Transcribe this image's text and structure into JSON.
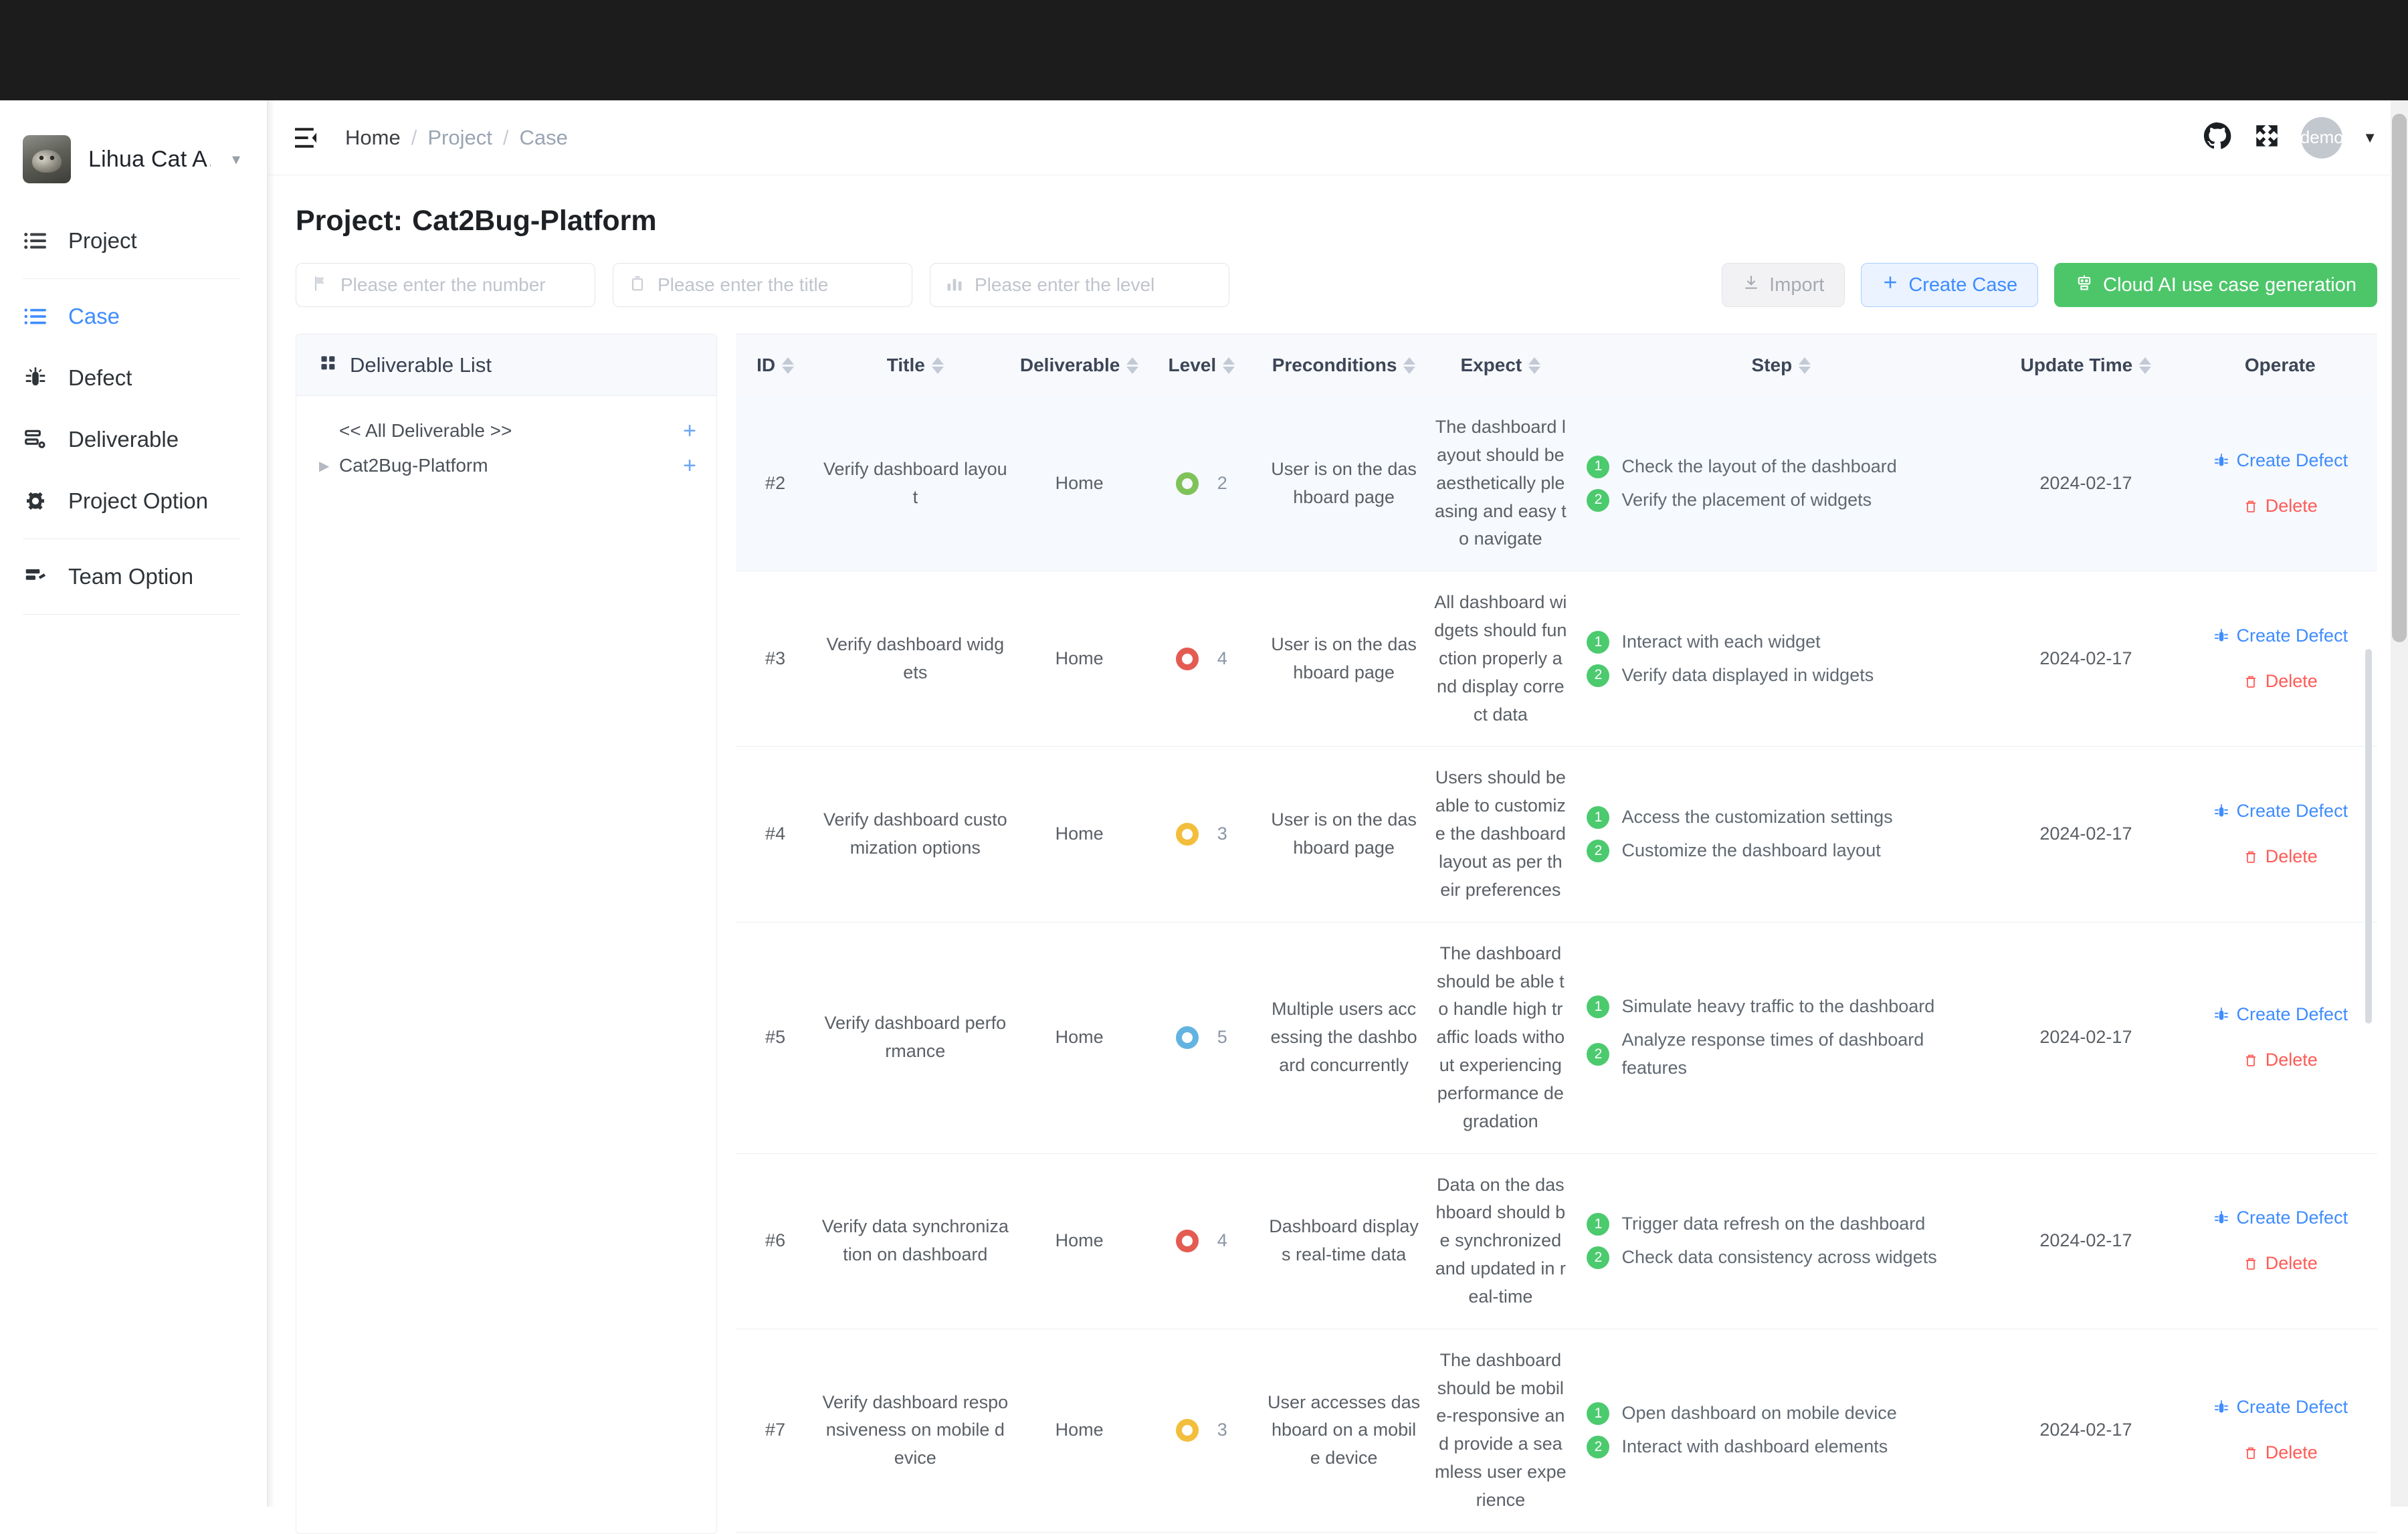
{
  "sidebar": {
    "org": {
      "name": "Lihua Cat A…",
      "avatar_icon": "cat-avatar",
      "caret_icon": "chevron-down-icon"
    },
    "items": [
      {
        "label": "Project",
        "icon": "list-icon",
        "active": false
      },
      {
        "label": "Case",
        "icon": "case-list-icon",
        "active": true
      },
      {
        "label": "Defect",
        "icon": "bug-icon",
        "active": false
      },
      {
        "label": "Deliverable",
        "icon": "deliverable-icon",
        "active": false
      },
      {
        "label": "Project Option",
        "icon": "gear-icon",
        "active": false
      },
      {
        "label": "Team Option",
        "icon": "team-option-icon",
        "active": false
      }
    ]
  },
  "topbar": {
    "menu_icon": "collapse-menu-icon",
    "breadcrumbs": [
      {
        "label": "Home",
        "current": true
      },
      {
        "label": "Project",
        "current": false
      },
      {
        "label": "Case",
        "current": false
      }
    ],
    "separator": "/",
    "github_icon": "github-icon",
    "fullscreen_icon": "fullscreen-icon",
    "user_avatar_label": "demo",
    "user_caret_icon": "caret-down-icon"
  },
  "page": {
    "title_prefix": "Project:",
    "title_name": "Cat2Bug-Platform"
  },
  "filters": [
    {
      "placeholder": "Please enter the number",
      "value": "",
      "icon": "flag-icon",
      "name": "number"
    },
    {
      "placeholder": "Please enter the title",
      "value": "",
      "icon": "clipboard-icon",
      "name": "title"
    },
    {
      "placeholder": "Please enter the level",
      "value": "",
      "icon": "bar-chart-icon",
      "name": "level"
    }
  ],
  "actions": {
    "import": {
      "label": "Import",
      "icon": "download-icon"
    },
    "create_case": {
      "label": "Create Case",
      "icon": "plus-icon"
    },
    "cloud_ai": {
      "label": "Cloud AI use case generation",
      "icon": "robot-icon"
    }
  },
  "deliverable_panel": {
    "title": "Deliverable List",
    "title_icon": "grid-icon",
    "rows": [
      {
        "label": "<< All Deliverable >>",
        "expandable": false,
        "add_icon": "plus-icon"
      },
      {
        "label": "Cat2Bug-Platform",
        "expandable": true,
        "add_icon": "plus-icon",
        "arrow_icon": "caret-right-icon"
      }
    ]
  },
  "table": {
    "columns": [
      {
        "label": "ID",
        "sortable": true
      },
      {
        "label": "Title",
        "sortable": true
      },
      {
        "label": "Deliverable",
        "sortable": true
      },
      {
        "label": "Level",
        "sortable": true
      },
      {
        "label": "Preconditions",
        "sortable": true
      },
      {
        "label": "Expect",
        "sortable": true
      },
      {
        "label": "Step",
        "sortable": true
      },
      {
        "label": "Update Time",
        "sortable": true
      },
      {
        "label": "Operate",
        "sortable": false
      }
    ],
    "row_actions": {
      "create_defect": {
        "label": "Create Defect",
        "icon": "bug-icon",
        "color": "#3f8cff"
      },
      "delete": {
        "label": "Delete",
        "icon": "trash-icon",
        "color": "#ff5b56"
      }
    },
    "level_colors": {
      "green": "#7fc25a",
      "red": "#e45b52",
      "yellow": "#f2be3c",
      "blue": "#63b3e0"
    },
    "rows": [
      {
        "id": "#2",
        "title": "Verify dashboard layout",
        "deliverable": "Home",
        "level": "2",
        "level_color": "green",
        "preconditions": "User is on the dashboard page",
        "expect": "The dashboard layout should be aesthetically pleasing and easy to navigate",
        "steps": [
          "Check the layout of the dashboard",
          "Verify the placement of widgets"
        ],
        "update_time": "2024-02-17",
        "highlight": true
      },
      {
        "id": "#3",
        "title": "Verify dashboard widgets",
        "deliverable": "Home",
        "level": "4",
        "level_color": "red",
        "preconditions": "User is on the dashboard page",
        "expect": "All dashboard widgets should function properly and display correct data",
        "steps": [
          "Interact with each widget",
          "Verify data displayed in widgets"
        ],
        "update_time": "2024-02-17",
        "highlight": false
      },
      {
        "id": "#4",
        "title": "Verify dashboard customization options",
        "deliverable": "Home",
        "level": "3",
        "level_color": "yellow",
        "preconditions": "User is on the dashboard page",
        "expect": "Users should be able to customize the dashboard layout as per their preferences",
        "steps": [
          "Access the customization settings",
          "Customize the dashboard layout"
        ],
        "update_time": "2024-02-17",
        "highlight": false
      },
      {
        "id": "#5",
        "title": "Verify dashboard performance",
        "deliverable": "Home",
        "level": "5",
        "level_color": "blue",
        "preconditions": "Multiple users accessing the dashboard concurrently",
        "expect": "The dashboard should be able to handle high traffic loads without experiencing performance degradation",
        "steps": [
          "Simulate heavy traffic to the dashboard",
          "Analyze response times of dashboard features"
        ],
        "update_time": "2024-02-17",
        "highlight": false
      },
      {
        "id": "#6",
        "title": "Verify data synchronization on dashboard",
        "deliverable": "Home",
        "level": "4",
        "level_color": "red",
        "preconditions": "Dashboard displays real-time data",
        "expect": "Data on the dashboard should be synchronized and updated in real-time",
        "steps": [
          "Trigger data refresh on the dashboard",
          "Check data consistency across widgets"
        ],
        "update_time": "2024-02-17",
        "highlight": false
      },
      {
        "id": "#7",
        "title": "Verify dashboard responsiveness on mobile device",
        "deliverable": "Home",
        "level": "3",
        "level_color": "yellow",
        "preconditions": "User accesses dashboard on a mobile device",
        "expect": "The dashboard should be mobile-responsive and provide a seamless user experience",
        "steps": [
          "Open dashboard on mobile device",
          "Interact with dashboard elements"
        ],
        "update_time": "2024-02-17",
        "highlight": false
      }
    ]
  }
}
